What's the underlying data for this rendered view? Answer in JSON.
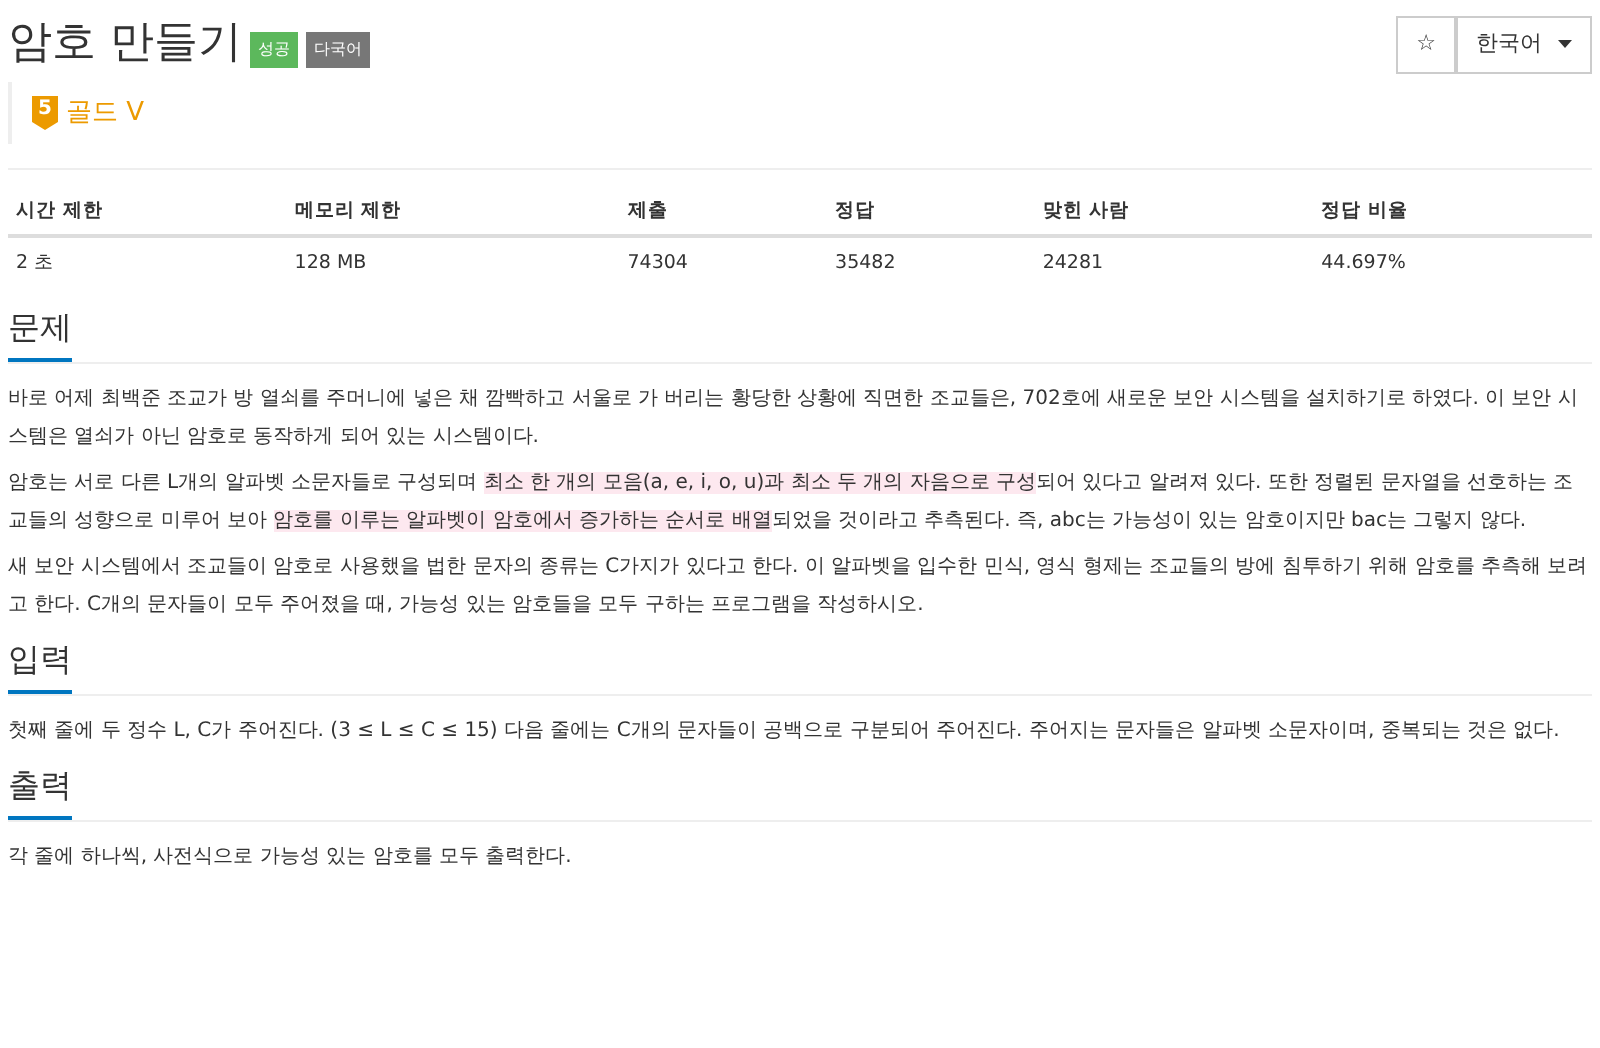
{
  "title": "암호 만들기",
  "labels": [
    {
      "text": "성공",
      "kind": "success"
    },
    {
      "text": "다국어",
      "kind": "multi"
    }
  ],
  "tier": {
    "level_number": "5",
    "name": "골드 V"
  },
  "star_button": "☆",
  "language_button": "한국어",
  "table": {
    "columns": [
      "시간 제한",
      "메모리 제한",
      "제출",
      "정답",
      "맞힌 사람",
      "정답 비율"
    ],
    "rows": [
      [
        "2 초",
        "128 MB",
        "74304",
        "35482",
        "24281",
        "44.697%"
      ]
    ]
  },
  "sections": [
    {
      "heading": "문제",
      "paragraphs": [
        [
          {
            "text": "바로 어제 최백준 조교가 방 열쇠를 주머니에 넣은 채 깜빡하고 서울로 가 버리는 황당한 상황에 직면한 조교들은, 702호에 새로운 보안 시스템을 설치하기로 하였다. 이 보안 시스템은 열쇠가 아닌 암호로 동작하게 되어 있는 시스템이다.",
            "highlight": false
          }
        ],
        [
          {
            "text": "암호는 서로 다른 L개의 알파벳 소문자들로 구성되며 ",
            "highlight": false
          },
          {
            "text": "최소 한 개의 모음(a, e, i, o, u)과 최소 두 개의 자음으로 구성",
            "highlight": true
          },
          {
            "text": "되어 있다고 알려져 있다. 또한 정렬된 문자열을 선호하는 조교들의 성향으로 미루어 보아 ",
            "highlight": false
          },
          {
            "text": "암호를 이루는 알파벳이 암호에서 증가하는 순서로 배열",
            "highlight": true
          },
          {
            "text": "되었을 것이라고 추측된다. 즉, abc는 가능성이 있는 암호이지만 bac는 그렇지 않다.",
            "highlight": false
          }
        ],
        [
          {
            "text": "새 보안 시스템에서 조교들이 암호로 사용했을 법한 문자의 종류는 C가지가 있다고 한다. 이 알파벳을 입수한 민식, 영식 형제는 조교들의 방에 침투하기 위해 암호를 추측해 보려고 한다. C개의 문자들이 모두 주어졌을 때, 가능성 있는 암호들을 모두 구하는 프로그램을 작성하시오.",
            "highlight": false
          }
        ]
      ]
    },
    {
      "heading": "입력",
      "paragraphs": [
        [
          {
            "text": "첫째 줄에 두 정수 L, C가 주어진다. (3 ≤ L ≤ C ≤ 15) 다음 줄에는 C개의 문자들이 공백으로 구분되어 주어진다. 주어지는 문자들은 알파벳 소문자이며, 중복되는 것은 없다.",
            "highlight": false
          }
        ]
      ]
    },
    {
      "heading": "출력",
      "paragraphs": [
        [
          {
            "text": "각 줄에 하나씩, 사전식으로 가능성 있는 암호를 모두 출력한다.",
            "highlight": false
          }
        ]
      ]
    }
  ]
}
